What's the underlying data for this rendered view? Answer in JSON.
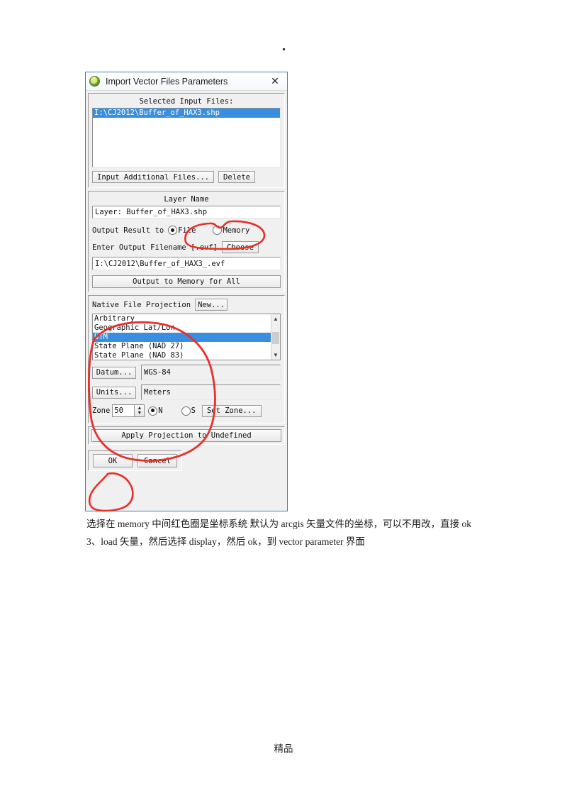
{
  "page": {
    "dot": ".",
    "footer": "精品"
  },
  "dialog": {
    "title": "Import Vector Files Parameters",
    "icon": "envi-globe-icon",
    "close_icon": "close-icon",
    "input_files": {
      "label": "Selected Input Files:",
      "items": [
        "I:\\CJ2012\\Buffer_of_HAX3.shp"
      ],
      "selected_index": 0,
      "buttons": {
        "add": "Input Additional Files...",
        "delete": "Delete"
      }
    },
    "layer": {
      "label": "Layer Name",
      "value": "Layer: Buffer_of_HAX3.shp",
      "output_label": "Output Result to",
      "options": [
        {
          "label": "File",
          "selected": true
        },
        {
          "label": "Memory",
          "selected": false
        }
      ],
      "filename_label": "Enter Output Filename [.evf]",
      "choose_button": "Choose",
      "filename_value": "I:\\CJ2012\\Buffer_of_HAX3_.evf",
      "memory_all_button": "Output to Memory for All"
    },
    "projection": {
      "label": "Native File Projection",
      "new_button": "New...",
      "list": [
        "Arbitrary",
        "Geographic Lat/Lon",
        "UTM",
        "State Plane (NAD 27)",
        "State Plane (NAD 83)"
      ],
      "selected_index": 2,
      "scroll_up_icon": "chevron-up-icon",
      "scroll_down_icon": "chevron-down-icon",
      "datum_button": "Datum...",
      "datum_value": "WGS-84",
      "units_button": "Units...",
      "units_value": "Meters",
      "zone_label": "Zone",
      "zone_value": "50",
      "hemispheres": [
        {
          "label": "N",
          "selected": true
        },
        {
          "label": "S",
          "selected": false
        }
      ],
      "set_zone_button": "Set Zone...",
      "apply_button": "Apply Projection to Undefined"
    },
    "footer_buttons": {
      "ok": "OK",
      "cancel": "Cancel"
    }
  },
  "document": {
    "paragraphs": [
      "选择在 memory 中间红色圈是坐标系统 默认为 arcgis 矢量文件的坐标，可以不用改，直接 ok",
      "3、load 矢量，然后选择 display，然后 ok，到 vector parameter 界面"
    ]
  },
  "annotations": {
    "color": "#e8302a",
    "marks": [
      "circle-around-memory-radio",
      "ellipse-around-projection-section",
      "circle-around-ok-button"
    ]
  }
}
